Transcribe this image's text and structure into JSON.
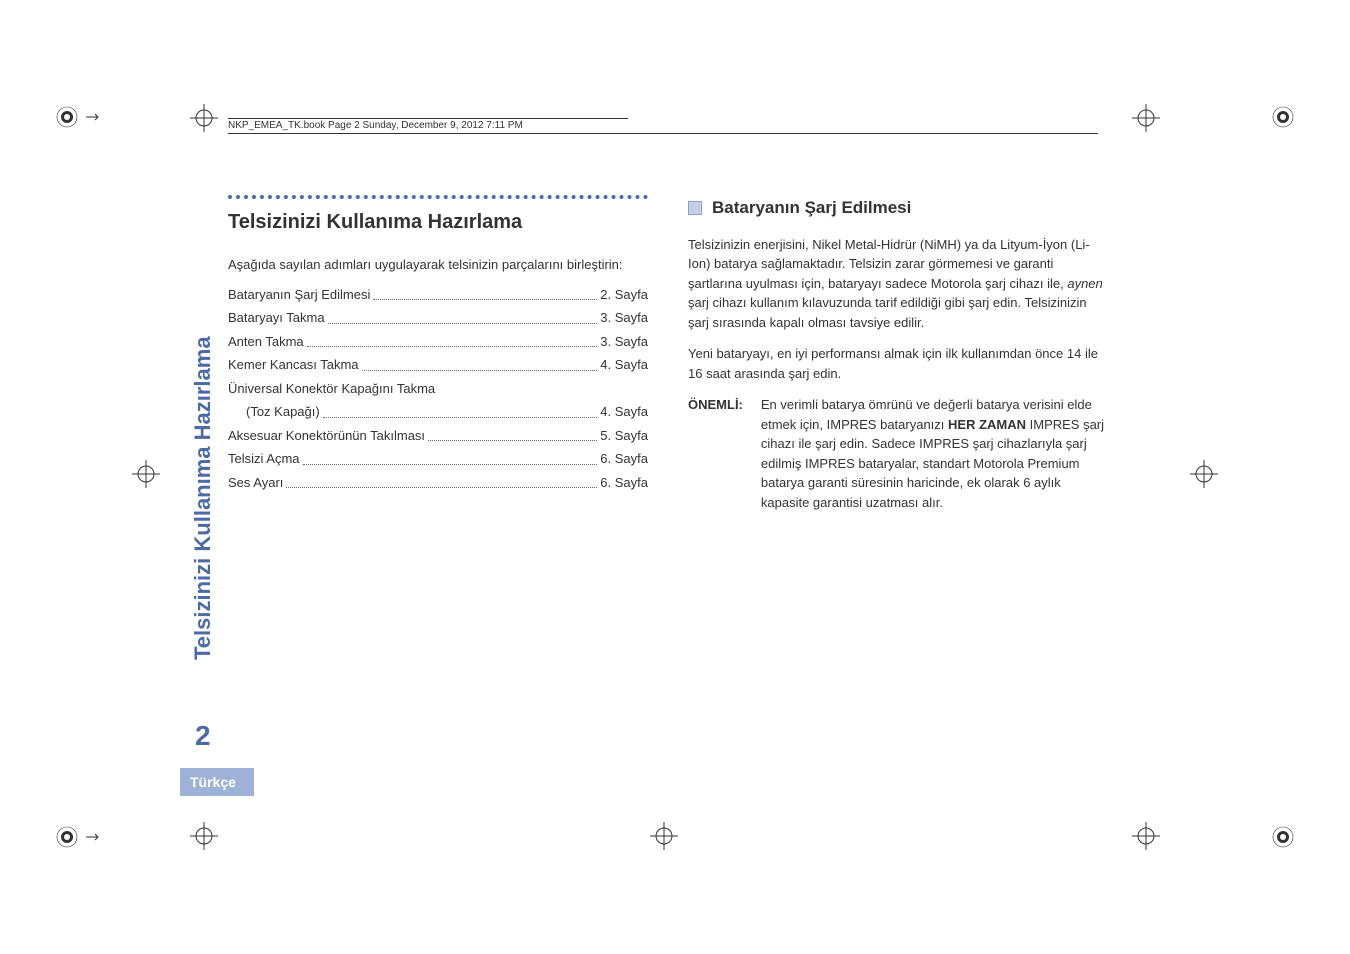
{
  "header_note": "NKP_EMEA_TK.book  Page 2  Sunday, December 9, 2012  7:11 PM",
  "sidebar_title": "Telsizinizi Kullanıma Hazırlama",
  "page_number": "2",
  "language_label": "Türkçe",
  "left": {
    "heading": "Telsizinizi Kullanıma Hazırlama",
    "intro": "Aşağıda sayılan adımları uygulayarak telsinizin parçalarını birleştirin:",
    "toc": [
      {
        "title": "Bataryanın Şarj Edilmesi",
        "page": "2. Sayfa"
      },
      {
        "title": "Bataryayı Takma",
        "page": "3. Sayfa"
      },
      {
        "title": "Anten Takma",
        "page": "3. Sayfa"
      },
      {
        "title": "Kemer Kancası Takma",
        "page": "4. Sayfa"
      },
      {
        "title": "Üniversal Konektör Kapağını Takma",
        "page": ""
      },
      {
        "title": "(Toz Kapağı)",
        "page": "4. Sayfa",
        "indent": true
      },
      {
        "title": "Aksesuar Konektörünün Takılması",
        "page": "5. Sayfa"
      },
      {
        "title": "Telsizi Açma",
        "page": "6. Sayfa"
      },
      {
        "title": "Ses Ayarı",
        "page": "6. Sayfa"
      }
    ]
  },
  "right": {
    "heading": "Bataryanın Şarj Edilmesi",
    "p1a": "Telsizinizin enerjisini, Nikel Metal-Hidrür (NiMH) ya da Lityum-İyon (Li-Ion) batarya sağlamaktadır. Telsizin zarar görmemesi ve garanti şartlarına uyulması için, bataryayı sadece Motorola şarj cihazı ile, ",
    "p1em": "aynen",
    "p1b": " şarj cihazı kullanım kılavuzunda tarif edildiği gibi şarj edin. Telsizinizin şarj sırasında kapalı olması tavsiye edilir.",
    "p2": "Yeni bataryayı, en iyi performansı almak için ilk kullanımdan önce 14 ile 16 saat arasında şarj edin.",
    "note_label": "ÖNEMLİ:",
    "note_a": "En verimli batarya ömrünü ve değerli batarya verisini elde etmek için, IMPRES bataryanızı ",
    "note_bold": "HER ZAMAN",
    "note_b": " IMPRES şarj cihazı ile şarj edin. Sadece IMPRES şarj cihazlarıyla şarj edilmiş IMPRES bataryalar, standart Motorola Premium batarya garanti süresinin haricinde, ek olarak 6 aylık kapasite garantisi uzatması alır."
  }
}
